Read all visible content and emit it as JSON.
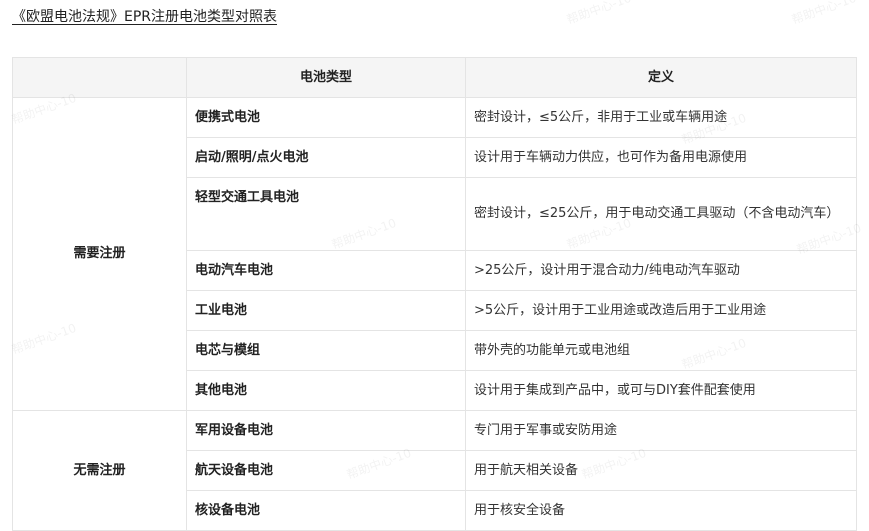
{
  "title": "《欧盟电池法规》EPR注册电池类型对照表",
  "watermark_text": "帮助中心-10",
  "table": {
    "headers": [
      "",
      "电池类型",
      "定义"
    ],
    "groups": [
      {
        "label": "需要注册",
        "rows": [
          {
            "type": "便携式电池",
            "definition": "密封设计，≤5公斤，非用于工业或车辆用途"
          },
          {
            "type": "启动/照明/点火电池",
            "definition": "设计用于车辆动力供应，也可作为备用电源使用"
          },
          {
            "type": "轻型交通工具电池",
            "definition": "密封设计，≤25公斤，用于电动交通工具驱动（不含电动汽车）"
          },
          {
            "type": "电动汽车电池",
            "definition": ">25公斤，设计用于混合动力/纯电动汽车驱动"
          },
          {
            "type": "工业电池",
            "definition": ">5公斤，设计用于工业用途或改造后用于工业用途"
          },
          {
            "type": "电芯与模组",
            "definition": "带外壳的功能单元或电池组"
          },
          {
            "type": "其他电池",
            "definition": "设计用于集成到产品中，或可与DIY套件配套使用"
          }
        ]
      },
      {
        "label": "无需注册",
        "rows": [
          {
            "type": "军用设备电池",
            "definition": "专门用于军事或安防用途"
          },
          {
            "type": "航天设备电池",
            "definition": "用于航天相关设备"
          },
          {
            "type": "核设备电池",
            "definition": "用于核安全设备"
          }
        ]
      }
    ]
  }
}
